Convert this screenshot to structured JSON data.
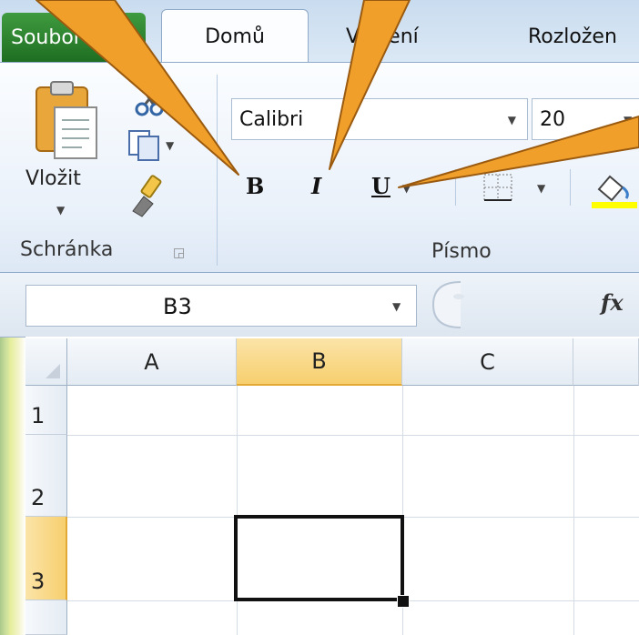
{
  "ribbon_tabs": {
    "file": "Soubor",
    "home": "Domů",
    "insert": "Vložení",
    "layout": "Rozložen"
  },
  "clipboard": {
    "paste_label": "Vložit",
    "group_label": "Schránka"
  },
  "font": {
    "family": "Calibri",
    "size": "20",
    "group_label": "Písmo",
    "bold_label": "B",
    "italic_label": "I",
    "underline_label": "U"
  },
  "formula_bar": {
    "name_box": "B3",
    "fx_label": "fx"
  },
  "grid": {
    "columns": [
      "A",
      "B",
      "C"
    ],
    "rows": [
      "1",
      "2",
      "3"
    ],
    "selected_cell": "B3"
  },
  "colors": {
    "callout": "#f0a02a",
    "file_tab": "#2a7d2e",
    "selected_header": "#f9d77e",
    "highlight": "#ffff00"
  }
}
